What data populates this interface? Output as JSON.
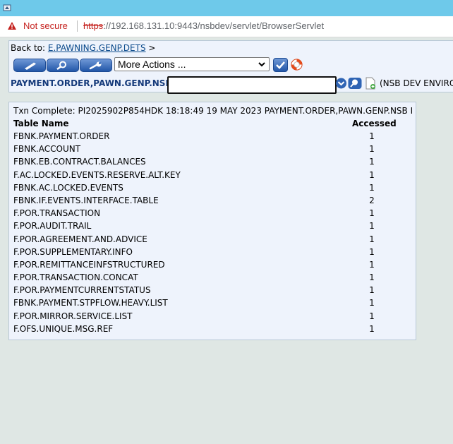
{
  "browser": {
    "security_label": "Not secure",
    "url_scheme": "https",
    "url_rest_pre": "://192.168.131.10",
    "url_rest_post": ":9443/nsbdev/servlet/BrowserServlet"
  },
  "toolbar": {
    "back_to_label": "Back to:",
    "back_to_link": "E.PAWNING.GENP.DETS",
    "back_to_suffix": ">",
    "actions_select_value": "More Actions ...",
    "command_label": "PAYMENT.ORDER,PAWN.GENP.NSB",
    "command_input_value": "",
    "environment_text": "(NSB DEV ENVIRO"
  },
  "result": {
    "txn_message": "Txn Complete: PI2025902P854HDK 18:18:49 19 MAY 2023 PAYMENT.ORDER,PAWN.GENP.NSB I",
    "columns": {
      "name": "Table Name",
      "accessed": "Accessed"
    },
    "rows": [
      {
        "name": "FBNK.PAYMENT.ORDER",
        "accessed": "1"
      },
      {
        "name": "FBNK.ACCOUNT",
        "accessed": "1"
      },
      {
        "name": "FBNK.EB.CONTRACT.BALANCES",
        "accessed": "1"
      },
      {
        "name": "F.AC.LOCKED.EVENTS.RESERVE.ALT.KEY",
        "accessed": "1"
      },
      {
        "name": "FBNK.AC.LOCKED.EVENTS",
        "accessed": "1"
      },
      {
        "name": "FBNK.IF.EVENTS.INTERFACE.TABLE",
        "accessed": "2"
      },
      {
        "name": "F.POR.TRANSACTION",
        "accessed": "1"
      },
      {
        "name": "F.POR.AUDIT.TRAIL",
        "accessed": "1"
      },
      {
        "name": "F.POR.AGREEMENT.AND.ADVICE",
        "accessed": "1"
      },
      {
        "name": "F.POR.SUPPLEMENTARY.INFO",
        "accessed": "1"
      },
      {
        "name": "F.POR.REMITTANCEINFSTRUCTURED",
        "accessed": "1"
      },
      {
        "name": "F.POR.TRANSACTION.CONCAT",
        "accessed": "1"
      },
      {
        "name": "F.POR.PAYMENTCURRENTSTATUS",
        "accessed": "1"
      },
      {
        "name": "FBNK.PAYMENT.STPFLOW.HEAVY.LIST",
        "accessed": "1"
      },
      {
        "name": "F.POR.MIRROR.SERVICE.LIST",
        "accessed": "1"
      },
      {
        "name": "F.OFS.UNIQUE.MSG.REF",
        "accessed": "1"
      }
    ]
  },
  "icons": {
    "app": "app-icon",
    "warning": "warning-icon",
    "edit": "pencil-icon",
    "view": "magnifier-icon",
    "tools": "wrench-icon",
    "ok": "checkmark-icon",
    "help": "lifebuoy-icon",
    "dropdown": "dropdown-icon",
    "find": "find-icon",
    "new": "new-document-icon"
  },
  "colors": {
    "titlebar": "#6ec9ea",
    "panel_bg": "#eef3fc",
    "page_bg": "#dfe7e4",
    "button_blue": "#2256a8",
    "link": "#0b4a8b",
    "warning": "#c5221f"
  }
}
